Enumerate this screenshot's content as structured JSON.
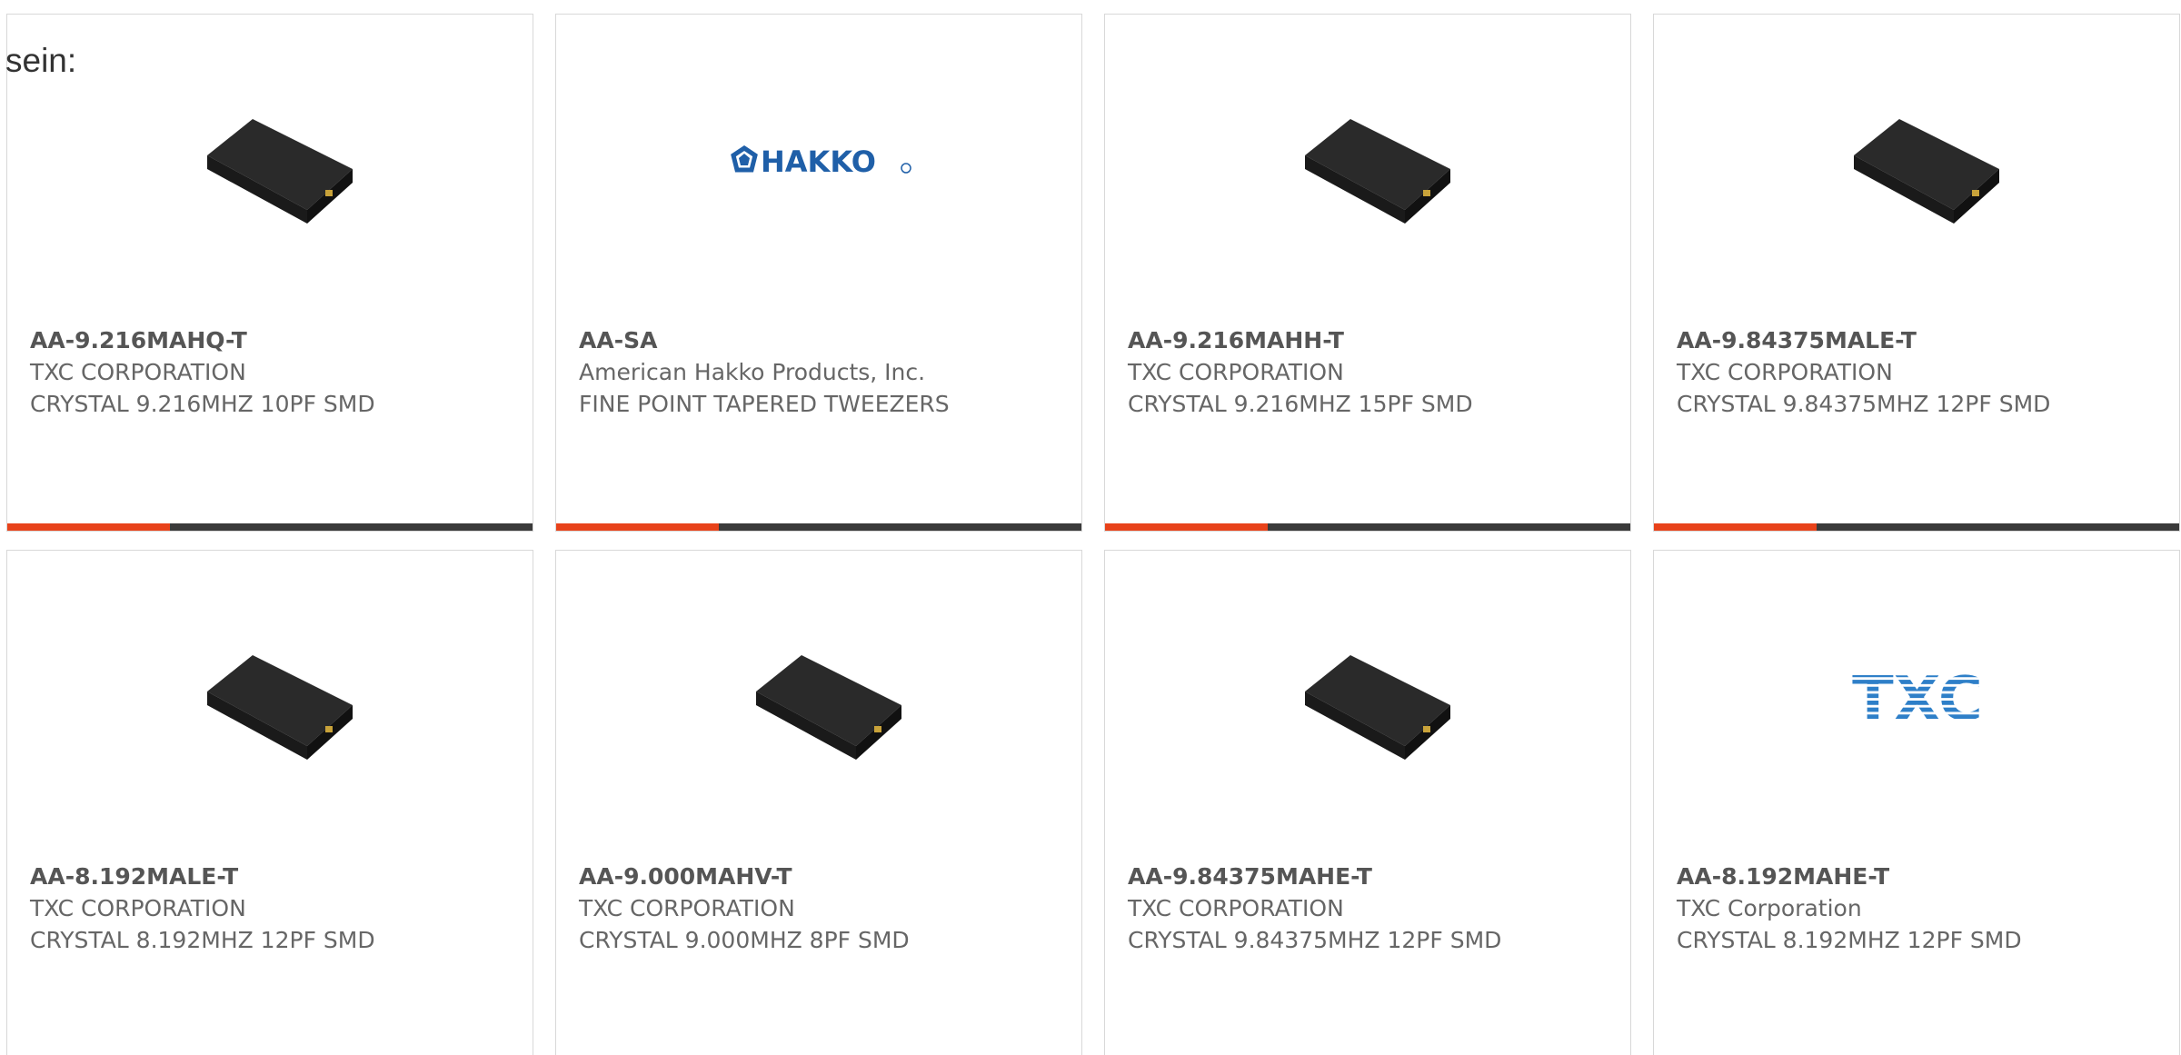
{
  "intro_text": "sein:",
  "colors": {
    "accent": "#e8421a",
    "bar": "#3a3a3a",
    "border": "#d8d8d8",
    "hakko_blue": "#1f5fa8",
    "txc_blue": "#2e7fc8"
  },
  "products": [
    {
      "part_number": "AA-9.216MAHQ-T",
      "manufacturer": "TXC CORPORATION",
      "description": "CRYSTAL 9.216MHZ 10PF SMD",
      "image": "crystal-chip"
    },
    {
      "part_number": "AA-SA",
      "manufacturer": "American Hakko Products, Inc.",
      "description": "FINE POINT TAPERED TWEEZERS",
      "image": "hakko-logo",
      "logo_text": "HAKKO"
    },
    {
      "part_number": "AA-9.216MAHH-T",
      "manufacturer": "TXC CORPORATION",
      "description": "CRYSTAL 9.216MHZ 15PF SMD",
      "image": "crystal-chip"
    },
    {
      "part_number": "AA-9.84375MALE-T",
      "manufacturer": "TXC CORPORATION",
      "description": "CRYSTAL 9.84375MHZ 12PF SMD",
      "image": "crystal-chip"
    },
    {
      "part_number": "AA-8.192MALE-T",
      "manufacturer": "TXC CORPORATION",
      "description": "CRYSTAL 8.192MHZ 12PF SMD",
      "image": "crystal-chip"
    },
    {
      "part_number": "AA-9.000MAHV-T",
      "manufacturer": "TXC CORPORATION",
      "description": "CRYSTAL 9.000MHZ 8PF SMD",
      "image": "crystal-chip"
    },
    {
      "part_number": "AA-9.84375MAHE-T",
      "manufacturer": "TXC CORPORATION",
      "description": "CRYSTAL 9.84375MHZ 12PF SMD",
      "image": "crystal-chip"
    },
    {
      "part_number": "AA-8.192MAHE-T",
      "manufacturer": "TXC Corporation",
      "description": "CRYSTAL 8.192MHZ 12PF SMD",
      "image": "txc-logo",
      "logo_text": "TXC"
    }
  ]
}
